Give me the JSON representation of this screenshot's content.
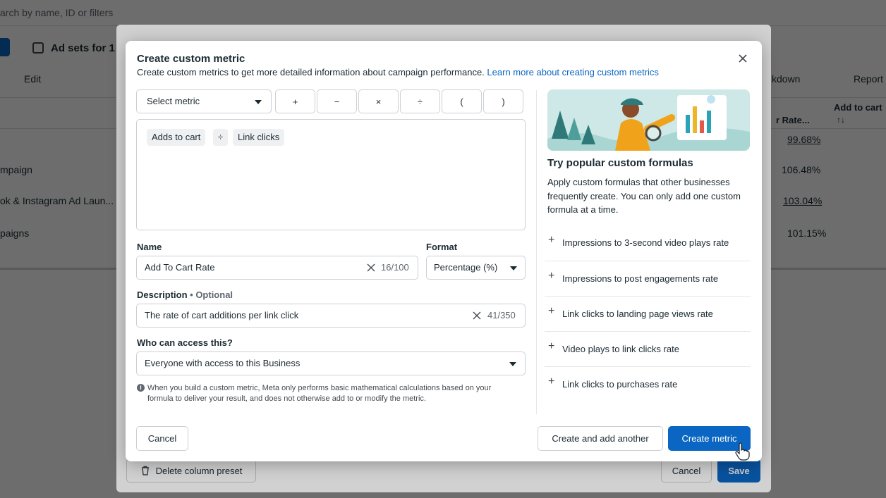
{
  "background": {
    "search_placeholder": "arch by name, ID or filters",
    "adsets_tab_label": "Ad sets for 1",
    "edit_label": "Edit",
    "breakdown_label": "kdown",
    "reports_label": "Report",
    "add_to_cart_header": "Add to cart",
    "sort_glyph": "↑↓",
    "rate_header": "r Rate...",
    "rows": [
      {
        "name": "",
        "value": "99.68%"
      },
      {
        "name": "mpaign",
        "value": "106.48%"
      },
      {
        "name": "ok & Instagram Ad Laun...",
        "value": "103.04%"
      },
      {
        "name": "paigns",
        "value": "101.15%"
      }
    ],
    "delete_preset_label": "Delete column preset",
    "cancel_label": "Cancel",
    "save_label": "Save"
  },
  "modal": {
    "title": "Create custom metric",
    "subtitle": "Create custom metrics to get more detailed information about campaign performance.",
    "learn_more_link": "Learn more about creating custom metrics",
    "select_metric_label": "Select metric",
    "operators": [
      "+",
      "−",
      "×",
      "÷",
      "(",
      ")"
    ],
    "formula_tokens": [
      "Adds to cart",
      "÷",
      "Link clicks"
    ],
    "name_label": "Name",
    "name_value": "Add To Cart Rate",
    "name_count": "16/100",
    "format_label": "Format",
    "format_value": "Percentage (%)",
    "description_label": "Description",
    "description_optional": "Optional",
    "description_value": "The rate of cart additions per link click",
    "description_count": "41/350",
    "access_label": "Who can access this?",
    "access_value": "Everyone with access to this Business",
    "info_note": "When you build a custom metric, Meta only performs basic mathematical calculations based on your formula to deliver your result, and does not otherwise add to or modify the metric.",
    "cancel_label": "Cancel",
    "create_another_label": "Create and add another",
    "create_label": "Create metric"
  },
  "right_panel": {
    "title": "Try popular custom formulas",
    "description": "Apply custom formulas that other businesses frequently create. You can only add one custom formula at a time.",
    "formulas": [
      "Impressions to 3-second video plays rate",
      "Impressions to post engagements rate",
      "Link clicks to landing page views rate",
      "Video plays to link clicks rate",
      "Link clicks to purchases rate"
    ]
  },
  "colors": {
    "primary": "#0a66c2",
    "text": "#1c2b33",
    "border": "#ccd0d5"
  }
}
